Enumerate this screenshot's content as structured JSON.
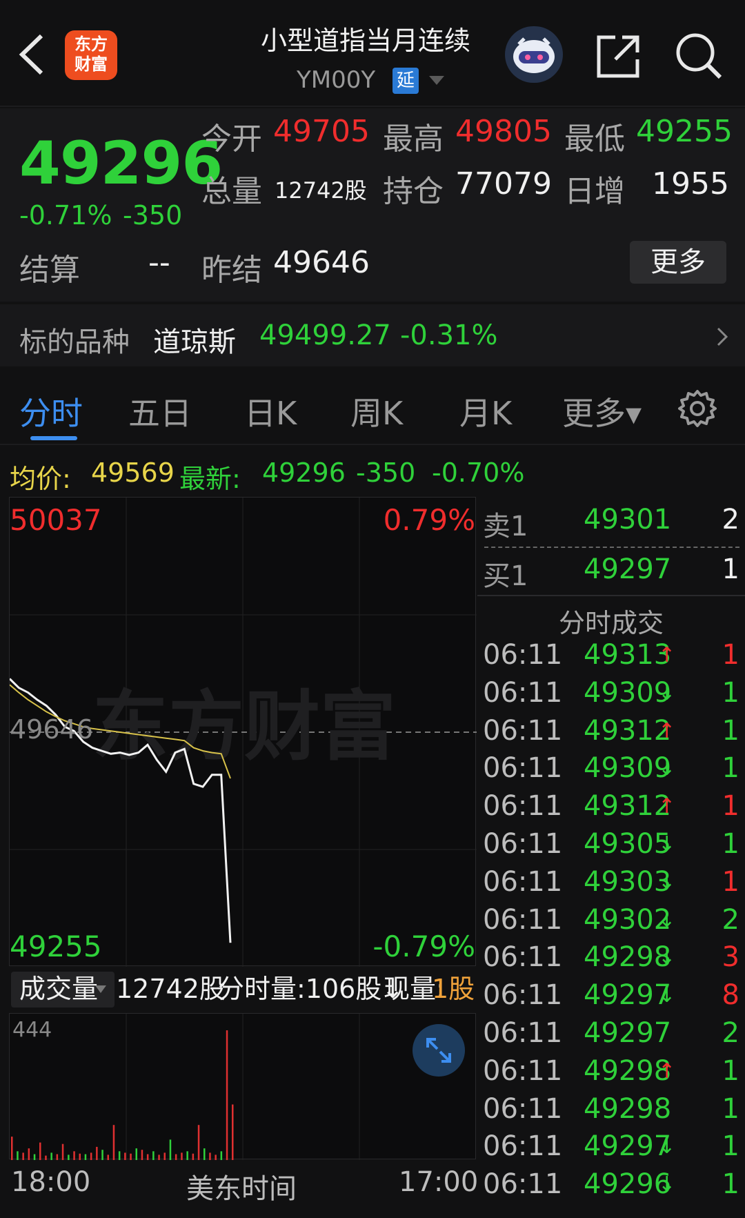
{
  "header": {
    "logo_line1": "东方",
    "logo_line2": "财富",
    "title": "小型道指当月连续",
    "symbol": "YM00Y",
    "delay_badge": "延"
  },
  "quote": {
    "price": "49296",
    "change_pct": "-0.71%",
    "change_abs": "-350",
    "open_label": "今开",
    "open": "49705",
    "high_label": "最高",
    "high": "49805",
    "low_label": "最低",
    "low": "49255",
    "volume_label": "总量",
    "volume": "12742股",
    "oi_label": "持仓",
    "oi": "77079",
    "daily_inc_label": "日增",
    "daily_inc": "1955",
    "settle_label": "结算",
    "settle": "--",
    "prev_settle_label": "昨结",
    "prev_settle": "49646",
    "more_label": "更多"
  },
  "underlying": {
    "label": "标的品种",
    "name": "道琼斯",
    "price": "49499.27",
    "pct": "-0.31%"
  },
  "tabs": [
    "分时",
    "五日",
    "日K",
    "周K",
    "月K",
    "更多▾"
  ],
  "avgbar": {
    "avg_label": "均价:",
    "avg_value": "49569",
    "latest_label": "最新:",
    "latest_value": "49296",
    "latest_change": "-350",
    "latest_pct": "-0.70%"
  },
  "chart_data": {
    "type": "line",
    "ylim": [
      49255,
      50037
    ],
    "y_top_label": "50037",
    "y_bottom_label": "49255",
    "y_mid_label": "49646",
    "pct_top_label": "0.79%",
    "pct_bottom_label": "-0.79%",
    "watermark": "东方财富",
    "series": [
      {
        "values": [
          49735,
          49720,
          49712,
          49700,
          49690,
          49675,
          49655,
          49648,
          49630,
          49620,
          49615,
          49610,
          49612,
          49608,
          49612,
          49625,
          49600,
          49580,
          49612,
          49618,
          49560,
          49555,
          49575,
          49575,
          49295
        ]
      },
      {
        "values": [
          49725,
          49712,
          49700,
          49690,
          49680,
          49672,
          49665,
          49660,
          49655,
          49652,
          49650,
          49648,
          49646,
          49644,
          49642,
          49640,
          49638,
          49636,
          49634,
          49632,
          49620,
          49615,
          49612,
          49610,
          49569
        ]
      }
    ],
    "volume_max_label": "444",
    "volume": [
      80,
      30,
      25,
      40,
      20,
      60,
      15,
      25,
      20,
      55,
      18,
      30,
      22,
      20,
      25,
      45,
      35,
      18,
      120,
      30,
      25,
      22,
      40,
      35,
      20,
      30,
      18,
      25,
      70,
      20,
      25,
      30,
      22,
      120,
      40,
      25,
      18,
      30,
      444,
      190
    ]
  },
  "volume_bar": {
    "select_label": "成交量",
    "total": "12742股",
    "tick_volume": "分时量:106股↓",
    "current_label": "现量:",
    "current_value": "1股"
  },
  "time_axis": {
    "start": "18:00",
    "middle": "美东时间",
    "end": "17:00"
  },
  "book": {
    "ask_label": "卖1",
    "ask_price": "49301",
    "ask_qty": "2",
    "bid_label": "买1",
    "bid_price": "49297",
    "bid_qty": "1",
    "ticks_title": "分时成交",
    "ticks": [
      {
        "time": "06:11",
        "price": "49313",
        "dir": "↑",
        "qty": "1",
        "qcolor": "red"
      },
      {
        "time": "06:11",
        "price": "49309",
        "dir": "↓",
        "qty": "1",
        "qcolor": "green"
      },
      {
        "time": "06:11",
        "price": "49312",
        "dir": "↑",
        "qty": "1",
        "qcolor": "green"
      },
      {
        "time": "06:11",
        "price": "49309",
        "dir": "↓",
        "qty": "1",
        "qcolor": "green"
      },
      {
        "time": "06:11",
        "price": "49312",
        "dir": "↑",
        "qty": "1",
        "qcolor": "red"
      },
      {
        "time": "06:11",
        "price": "49305",
        "dir": "↓",
        "qty": "1",
        "qcolor": "green"
      },
      {
        "time": "06:11",
        "price": "49303",
        "dir": "↓",
        "qty": "1",
        "qcolor": "red"
      },
      {
        "time": "06:11",
        "price": "49302",
        "dir": "↓",
        "qty": "2",
        "qcolor": "green"
      },
      {
        "time": "06:11",
        "price": "49298",
        "dir": "↓",
        "qty": "3",
        "qcolor": "red"
      },
      {
        "time": "06:11",
        "price": "49297",
        "dir": "↓",
        "qty": "8",
        "qcolor": "red"
      },
      {
        "time": "06:11",
        "price": "49297",
        "dir": "",
        "qty": "2",
        "qcolor": "green"
      },
      {
        "time": "06:11",
        "price": "49298",
        "dir": "↑",
        "qty": "1",
        "qcolor": "green"
      },
      {
        "time": "06:11",
        "price": "49298",
        "dir": "",
        "qty": "1",
        "qcolor": "green"
      },
      {
        "time": "06:11",
        "price": "49297",
        "dir": "↓",
        "qty": "1",
        "qcolor": "green"
      },
      {
        "time": "06:11",
        "price": "49296",
        "dir": "↓",
        "qty": "1",
        "qcolor": "green"
      }
    ]
  }
}
